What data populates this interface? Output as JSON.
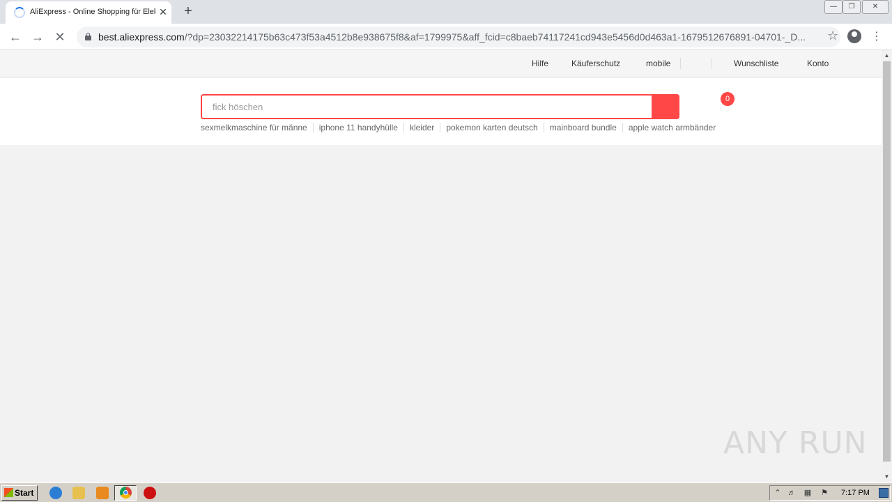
{
  "browser": {
    "tab_title": "AliExpress - Online Shopping für Elektronik",
    "tab_close": "✕",
    "new_tab": "+",
    "url_host": "best.aliexpress.com",
    "url_rest": "/?dp=23032214175b63c473f53a4512b8e938675f8&af=1799975&aff_fcid=c8baeb74117241cd943e5456d0d463a1-1679512676891-04701-_D...",
    "window_controls": [
      "—",
      "❐",
      "✕"
    ]
  },
  "topbar": {
    "links": [
      "Hilfe",
      "Käuferschutz",
      "mobile",
      "Wunschliste",
      "Konto"
    ]
  },
  "search": {
    "placeholder": "fick höschen",
    "hot_words": [
      "sexmelkmaschine für männe",
      "iphone 11 handyhülle",
      "kleider",
      "pokemon karten deutsch",
      "mainboard bundle",
      "apple watch armbänder"
    ]
  },
  "cart": {
    "count": "0"
  },
  "watermark": "ANY RUN",
  "taskbar": {
    "start_label": "Start",
    "clock": "7:17 PM"
  },
  "colors": {
    "accent": "#ff4747",
    "chrome_blue": "#1a73e8"
  }
}
